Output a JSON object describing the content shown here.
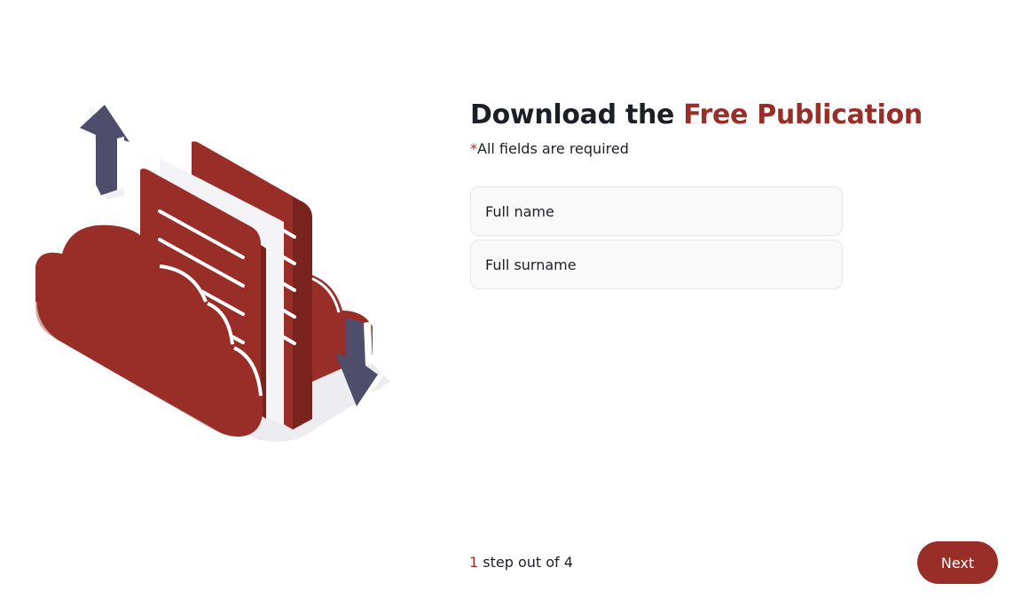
{
  "illustration": {
    "icon": "cloud-documents-transfer-icon",
    "colors": {
      "primary": "#992d27",
      "arrow": "#4e4d6b",
      "shadow": "#e9e9ee"
    }
  },
  "header": {
    "title_prefix": "Download the ",
    "title_accent": "Free Publication"
  },
  "required_note": {
    "star": "*",
    "text": "All fields are required"
  },
  "form": {
    "full_name_placeholder": "Full name",
    "full_surname_placeholder": "Full surname"
  },
  "footer": {
    "current_step": "1",
    "step_text": " step out of 4",
    "next_label": "Next"
  },
  "theme": {
    "accent": "#992d27",
    "text": "#1c1f26",
    "field_bg": "#f9f9f9"
  }
}
